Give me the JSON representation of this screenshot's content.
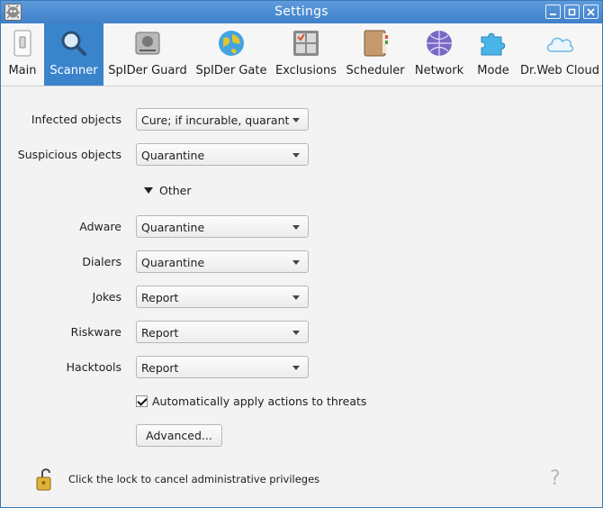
{
  "window": {
    "title": "Settings"
  },
  "toolbar": {
    "tabs": [
      {
        "label": "Main",
        "icon": "switch-icon",
        "active": false
      },
      {
        "label": "Scanner",
        "icon": "magnifier-icon",
        "active": true
      },
      {
        "label": "SpIDer Guard",
        "icon": "guard-icon",
        "active": false
      },
      {
        "label": "SpIDer Gate",
        "icon": "globe-icon",
        "active": false
      },
      {
        "label": "Exclusions",
        "icon": "exclusions-icon",
        "active": false
      },
      {
        "label": "Scheduler",
        "icon": "book-icon",
        "active": false
      },
      {
        "label": "Network",
        "icon": "network-icon",
        "active": false
      },
      {
        "label": "Mode",
        "icon": "puzzle-icon",
        "active": false
      },
      {
        "label": "Dr.Web Cloud",
        "icon": "cloud-icon",
        "active": false
      }
    ]
  },
  "form": {
    "infected": {
      "label": "Infected objects",
      "value": "Cure; if incurable, quarantine"
    },
    "suspicious": {
      "label": "Suspicious objects",
      "value": "Quarantine"
    },
    "other_label": "Other",
    "adware": {
      "label": "Adware",
      "value": "Quarantine"
    },
    "dialers": {
      "label": "Dialers",
      "value": "Quarantine"
    },
    "jokes": {
      "label": "Jokes",
      "value": "Report"
    },
    "riskware": {
      "label": "Riskware",
      "value": "Report"
    },
    "hacktools": {
      "label": "Hacktools",
      "value": "Report"
    },
    "auto_apply": {
      "label": "Automatically apply actions to threats",
      "checked": true
    },
    "advanced_button": "Advanced..."
  },
  "footer": {
    "lock_text": "Click the lock to cancel administrative privileges",
    "help": "?"
  },
  "colors": {
    "title_bar": "#4a8ad1",
    "active_tab": "#3a84cc"
  }
}
